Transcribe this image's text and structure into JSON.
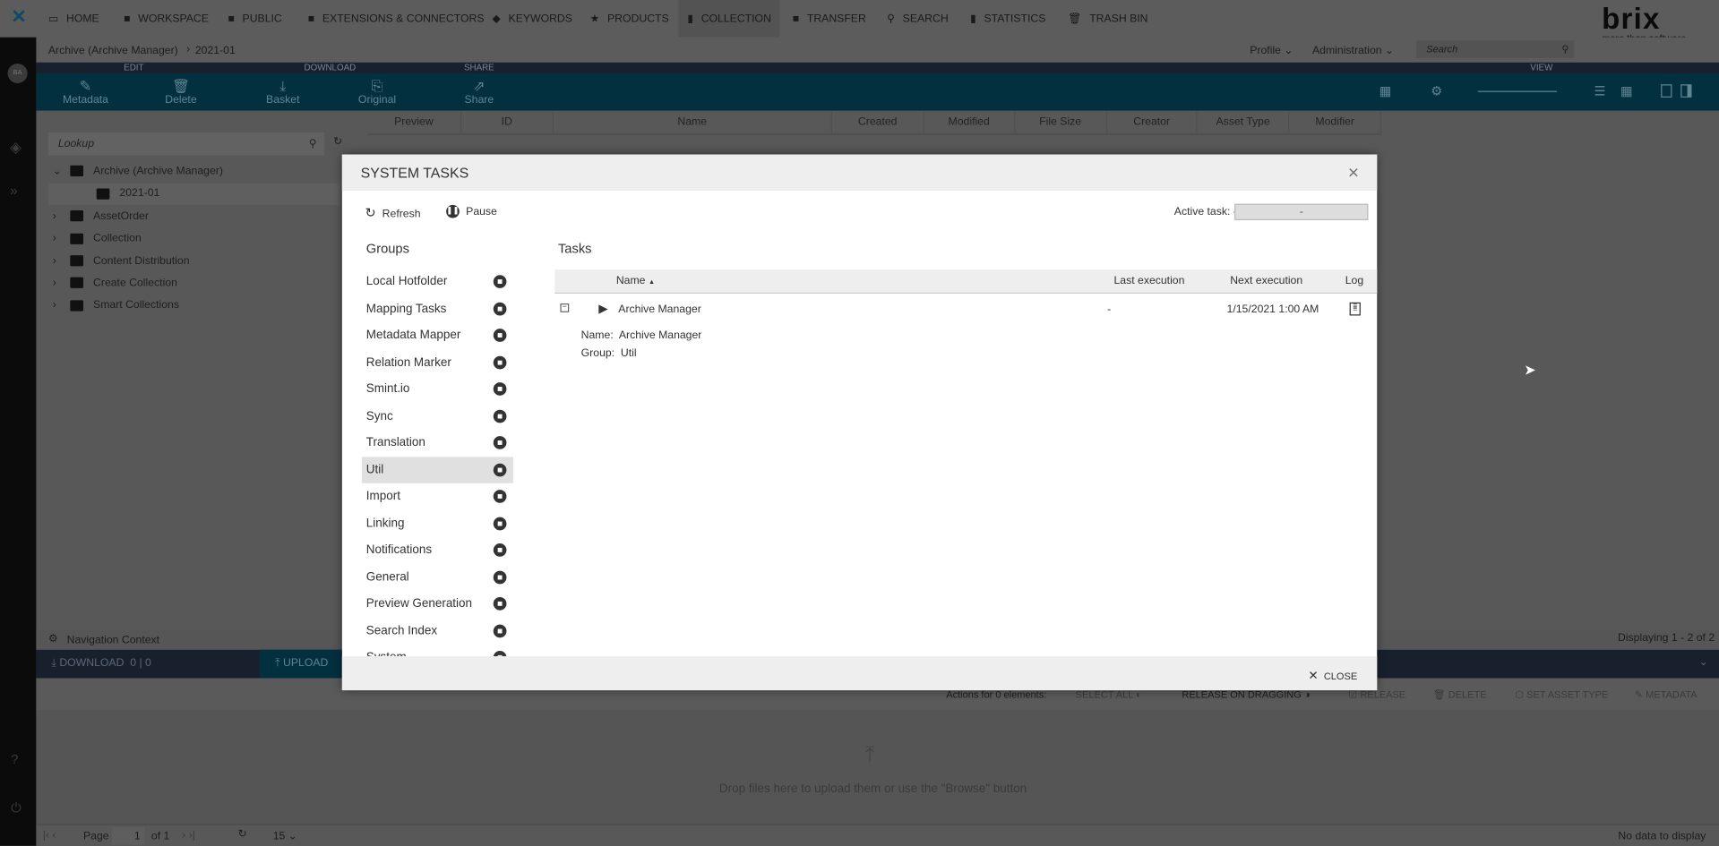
{
  "nav": {
    "items": [
      {
        "label": "HOME",
        "icon": "monitor-icon"
      },
      {
        "label": "WORKSPACE",
        "icon": "folder-icon"
      },
      {
        "label": "PUBLIC",
        "icon": "folder-icon"
      },
      {
        "label": "EXTENSIONS & CONNECTORS",
        "icon": "folder-icon"
      },
      {
        "label": "KEYWORDS",
        "icon": "tag-icon"
      },
      {
        "label": "PRODUCTS",
        "icon": "star-icon"
      },
      {
        "label": "COLLECTION",
        "icon": "briefcase-icon",
        "active": true
      },
      {
        "label": "TRANSFER",
        "icon": "folder-icon"
      },
      {
        "label": "SEARCH",
        "icon": "search-icon"
      },
      {
        "label": "STATISTICS",
        "icon": "bar-chart-icon"
      },
      {
        "label": "TRASH BIN",
        "icon": "trash-icon"
      }
    ],
    "logo": "brix",
    "logo_tagline": "more than software",
    "profile": "Profile",
    "administration": "Administration",
    "search_placeholder": "Search"
  },
  "rail": {
    "avatar": "BA"
  },
  "breadcrumb": [
    "Archive (Archive Manager)",
    "2021-01"
  ],
  "toolbar": {
    "sections": [
      "EDIT",
      "DOWNLOAD",
      "SHARE",
      "VIEW"
    ],
    "buttons": [
      "Metadata",
      "Delete",
      "Basket",
      "Original",
      "Share"
    ]
  },
  "grid": {
    "columns": [
      "Preview",
      "ID",
      "Name",
      "Created",
      "Modified",
      "File Size",
      "Creator",
      "Asset Type",
      "Modifier"
    ]
  },
  "tree": {
    "lookup_placeholder": "Lookup",
    "items": [
      "Archive (Archive Manager)",
      "2021-01",
      "AssetOrder",
      "Collection",
      "Content Distribution",
      "Create Collection",
      "Smart Collections"
    ]
  },
  "bottom": {
    "nav_context": "Navigation Context",
    "displaying": "Displaying 1 - 2 of 2",
    "download": "DOWNLOAD",
    "download_count": "0 | 0",
    "upload": "UPLOAD",
    "actions_label": "Actions for 0 elements:",
    "select_all": "SELECT ALL",
    "release_on_dragging": "RELEASE ON DRAGGING",
    "release": "RELEASE",
    "delete": "DELETE",
    "set_asset_type": "SET ASSET TYPE",
    "metadata": "METADATA",
    "drop_text": "Drop files here to upload them or use the \"Browse\" button",
    "page_label": "Page",
    "page": "1",
    "of": "of 1",
    "page_size": "15",
    "no_data": "No data to display"
  },
  "dialog": {
    "title": "SYSTEM TASKS",
    "refresh": "Refresh",
    "pause": "Pause",
    "active_task_label": "Active task: -",
    "active_task_value": "-",
    "groups_title": "Groups",
    "tasks_title": "Tasks",
    "groups": [
      "Local Hotfolder",
      "Mapping Tasks",
      "Metadata Mapper",
      "Relation Marker",
      "Smint.io",
      "Sync",
      "Translation",
      "Util",
      "Import",
      "Linking",
      "Notifications",
      "General",
      "Preview Generation",
      "Search Index",
      "System"
    ],
    "selected_group": "Util",
    "columns": {
      "name": "Name",
      "last": "Last execution",
      "next": "Next execution",
      "log": "Log"
    },
    "task": {
      "name": "Archive Manager",
      "last": "-",
      "next": "1/15/2021 1:00 AM",
      "detail_name_label": "Name:",
      "detail_name": "Archive Manager",
      "detail_group_label": "Group:",
      "detail_group": "Util"
    },
    "close": "CLOSE"
  }
}
